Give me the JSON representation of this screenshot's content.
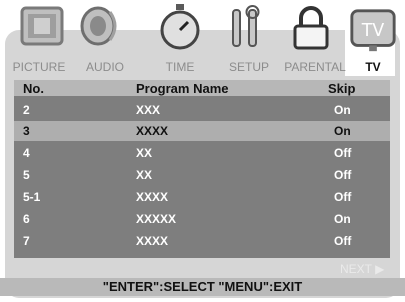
{
  "tabs": [
    {
      "label": "PICTURE",
      "icon": "picture-icon"
    },
    {
      "label": "AUDIO",
      "icon": "speaker-icon"
    },
    {
      "label": "TIME",
      "icon": "clock-icon"
    },
    {
      "label": "SETUP",
      "icon": "tools-icon"
    },
    {
      "label": "PARENTAL",
      "icon": "lock-icon"
    },
    {
      "label": "TV",
      "icon": "tv-icon",
      "active": true
    }
  ],
  "tv_icon_text": "TV",
  "table": {
    "headers": {
      "no": "No.",
      "name": "Program Name",
      "skip": "Skip"
    },
    "rows": [
      {
        "no": "2",
        "name": "XXX",
        "skip": "On"
      },
      {
        "no": "3",
        "name": "XXXX",
        "skip": "On",
        "selected": true
      },
      {
        "no": "4",
        "name": "XX",
        "skip": "Off"
      },
      {
        "no": "5",
        "name": "XX",
        "skip": "Off"
      },
      {
        "no": "5-1",
        "name": "XXXX",
        "skip": "Off"
      },
      {
        "no": "6",
        "name": "XXXXX",
        "skip": "On"
      },
      {
        "no": "7",
        "name": "XXXX",
        "skip": "Off"
      }
    ]
  },
  "next_label": "NEXT ▶",
  "footer_text": "\"ENTER\":SELECT   \"MENU\":EXIT",
  "colors": {
    "frame": "#d6d6d6",
    "table_bg": "#7e7e7e",
    "header_bg": "#b7b7b7",
    "selected_row": "#aeaeae"
  }
}
